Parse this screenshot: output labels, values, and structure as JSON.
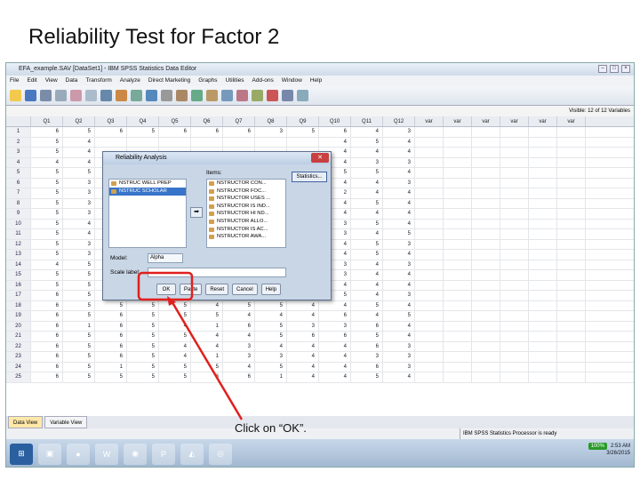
{
  "slide_title": "Reliability Test for Factor 2",
  "window": {
    "title": "EFA_example.SAV [DataSet1] - IBM SPSS Statistics Data Editor"
  },
  "menu": [
    "File",
    "Edit",
    "View",
    "Data",
    "Transform",
    "Analyze",
    "Direct Marketing",
    "Graphs",
    "Utilities",
    "Add-ons",
    "Window",
    "Help"
  ],
  "visible_info": "Visible: 12 of 12 Variables",
  "columns": [
    "Q1",
    "Q2",
    "Q3",
    "Q4",
    "Q5",
    "Q6",
    "Q7",
    "Q8",
    "Q9",
    "Q10",
    "Q11",
    "Q12",
    "var",
    "var",
    "var",
    "var",
    "var",
    "var"
  ],
  "rows": [
    [
      "1",
      "6",
      "5",
      "6",
      "5",
      "6",
      "6",
      "6",
      "3",
      "5",
      "6",
      "4",
      "3"
    ],
    [
      "2",
      "5",
      "4",
      "",
      "",
      "",
      "",
      "",
      "",
      "",
      "4",
      "5",
      "4"
    ],
    [
      "3",
      "5",
      "4",
      "",
      "",
      "",
      "",
      "",
      "",
      "",
      "4",
      "4",
      "4"
    ],
    [
      "4",
      "4",
      "4",
      "",
      "",
      "",
      "",
      "",
      "",
      "",
      "4",
      "3",
      "3"
    ],
    [
      "5",
      "5",
      "5",
      "",
      "",
      "",
      "",
      "",
      "",
      "",
      "5",
      "5",
      "4"
    ],
    [
      "6",
      "5",
      "3",
      "",
      "",
      "",
      "",
      "",
      "",
      "",
      "4",
      "4",
      "3"
    ],
    [
      "7",
      "5",
      "3",
      "",
      "",
      "",
      "",
      "",
      "",
      "",
      "2",
      "4",
      "4"
    ],
    [
      "8",
      "5",
      "3",
      "",
      "",
      "",
      "",
      "",
      "",
      "",
      "4",
      "5",
      "4"
    ],
    [
      "9",
      "5",
      "3",
      "",
      "",
      "",
      "",
      "",
      "",
      "",
      "4",
      "4",
      "4"
    ],
    [
      "10",
      "5",
      "4",
      "",
      "",
      "",
      "",
      "",
      "",
      "",
      "3",
      "5",
      "4"
    ],
    [
      "11",
      "5",
      "4",
      "",
      "",
      "",
      "",
      "",
      "",
      "",
      "3",
      "4",
      "5"
    ],
    [
      "12",
      "5",
      "3",
      "",
      "",
      "",
      "",
      "",
      "",
      "",
      "4",
      "5",
      "3"
    ],
    [
      "13",
      "5",
      "3",
      "",
      "",
      "",
      "",
      "",
      "",
      "",
      "4",
      "5",
      "4"
    ],
    [
      "14",
      "4",
      "5",
      "",
      "",
      "",
      "",
      "",
      "",
      "",
      "3",
      "4",
      "3"
    ],
    [
      "15",
      "5",
      "5",
      "",
      "",
      "",
      "",
      "",
      "",
      "",
      "3",
      "4",
      "4"
    ],
    [
      "16",
      "5",
      "5",
      "",
      "",
      "",
      "",
      "",
      "",
      "",
      "4",
      "4",
      "4"
    ],
    [
      "17",
      "6",
      "5",
      "6",
      "5",
      "5",
      "4",
      "4",
      "5",
      "4",
      "5",
      "4",
      "3"
    ],
    [
      "18",
      "6",
      "5",
      "5",
      "5",
      "5",
      "4",
      "5",
      "5",
      "4",
      "4",
      "5",
      "4"
    ],
    [
      "19",
      "6",
      "5",
      "6",
      "5",
      "5",
      "5",
      "4",
      "4",
      "4",
      "6",
      "4",
      "5"
    ],
    [
      "20",
      "6",
      "1",
      "6",
      "5",
      "4",
      "1",
      "6",
      "5",
      "3",
      "3",
      "6",
      "4"
    ],
    [
      "21",
      "6",
      "5",
      "6",
      "5",
      "5",
      "4",
      "4",
      "5",
      "6",
      "6",
      "5",
      "4"
    ],
    [
      "22",
      "6",
      "5",
      "6",
      "5",
      "4",
      "4",
      "3",
      "4",
      "4",
      "4",
      "6",
      "3"
    ],
    [
      "23",
      "6",
      "5",
      "6",
      "5",
      "4",
      "1",
      "3",
      "3",
      "4",
      "4",
      "3",
      "3"
    ],
    [
      "24",
      "6",
      "5",
      "1",
      "5",
      "5",
      "5",
      "4",
      "5",
      "4",
      "4",
      "6",
      "3"
    ],
    [
      "25",
      "6",
      "5",
      "5",
      "5",
      "5",
      "6",
      "6",
      "1",
      "4",
      "4",
      "5",
      "4"
    ]
  ],
  "tabs": {
    "data_view": "Data View",
    "variable_view": "Variable View"
  },
  "status": "IBM SPSS Statistics Processor is ready",
  "dialog": {
    "title": "Reliability Analysis",
    "source_items": [
      "NSTRUC WELL PREP",
      "NSTRUC SCHOLAR"
    ],
    "items_label": "Items:",
    "items": [
      "NSTRUCTOR CON...",
      "NSTRUCTOR FOC...",
      "NSTRUCTOR USES ...",
      "NSTRUCTOR IS IND...",
      "NSTRUCTOR HI ND...",
      "NSTRUCTOR ALLO...",
      "NSTRUCTOR IS AC...",
      "NSTRUCTOR AWA..."
    ],
    "statistics_btn": "Statistics...",
    "model_label": "Model:",
    "model_value": "Alpha",
    "scale_label": "Scale label:",
    "buttons": {
      "ok": "OK",
      "paste": "Paste",
      "reset": "Reset",
      "cancel": "Cancel",
      "help": "Help"
    }
  },
  "callout": "Click on “OK”.",
  "tray": {
    "battery": "100%",
    "time": "2:53 AM",
    "date": "3/26/2015"
  },
  "accent_color": "#e0201e"
}
